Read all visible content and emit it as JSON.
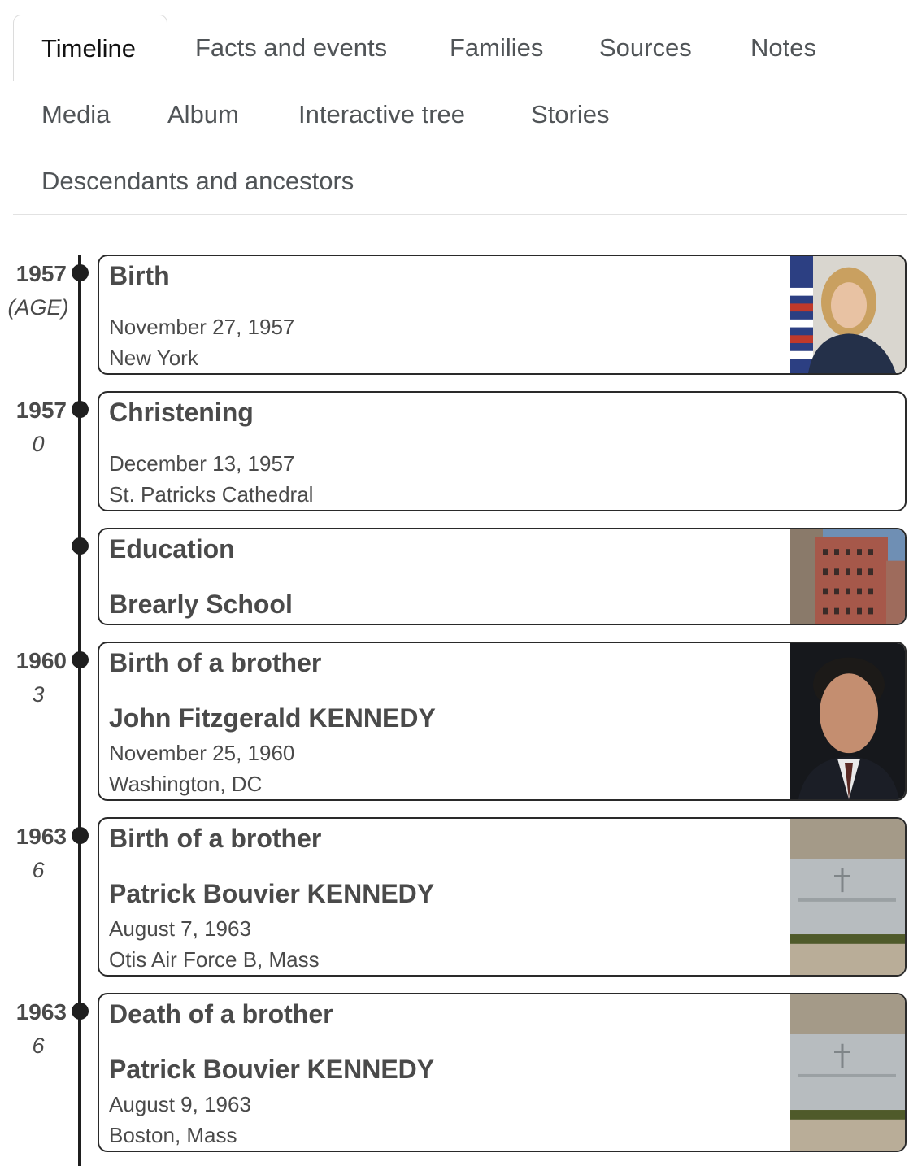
{
  "tabs": {
    "timeline": "Timeline",
    "facts": "Facts and events",
    "families": "Families",
    "sources": "Sources",
    "notes": "Notes",
    "media": "Media",
    "album": "Album",
    "tree": "Interactive tree",
    "stories": "Stories",
    "descendants": "Descendants and ancestors",
    "active": "Timeline"
  },
  "timeline": {
    "events": [
      {
        "year": "1957",
        "age": "(AGE)",
        "title": "Birth",
        "date": "November 27, 1957",
        "place": "New York",
        "photo": "portrait-woman-flag"
      },
      {
        "year": "1957",
        "age": "0",
        "title": "Christening",
        "date": "December 13, 1957",
        "place": "St. Patricks Cathedral"
      },
      {
        "title": "Education",
        "detail": "Brearly School",
        "photo": "school-building"
      },
      {
        "year": "1960",
        "age": "3",
        "title": "Birth of a brother",
        "person": "John Fitzgerald KENNEDY",
        "date": "November 25, 1960",
        "place": "Washington, DC",
        "photo": "portrait-man"
      },
      {
        "year": "1963",
        "age": "6",
        "title": "Birth of a brother",
        "person": "Patrick Bouvier KENNEDY",
        "date": "August 7, 1963",
        "place": "Otis Air Force B, Mass",
        "photo": "gravestone"
      },
      {
        "year": "1963",
        "age": "6",
        "title": "Death of a brother",
        "person": "Patrick Bouvier KENNEDY",
        "date": "August 9, 1963",
        "place": "Boston, Mass",
        "photo": "gravestone"
      }
    ]
  },
  "colors": {
    "timeline_line": "#1f1f1f",
    "card_border": "#2a2a2a",
    "text": "#4a4a4a",
    "active_tab_text": "#111111"
  }
}
